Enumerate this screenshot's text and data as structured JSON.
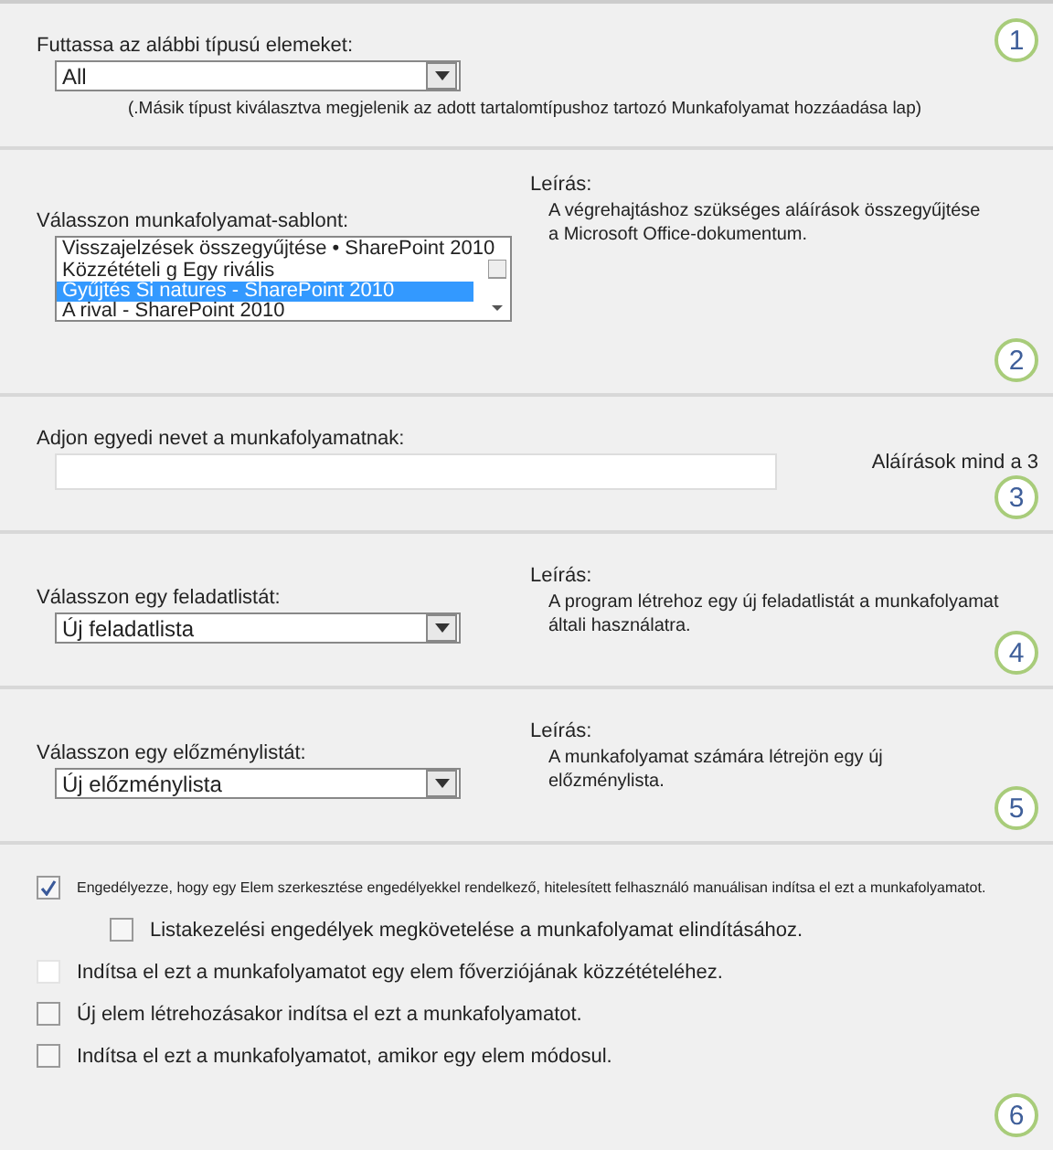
{
  "item_type": {
    "step": "1",
    "label": "Futtassa az alábbi típusú elemeket:",
    "dropdown": {
      "value": "All"
    },
    "note": "(.Másik típust kiválasztva megjelenik az adott tartalomtípushoz tartozó Munkafolyamat hozzáadása lap)"
  },
  "template": {
    "step": "2",
    "label": "Válasszon munkafolyamat-sablont:",
    "items": [
      {
        "text": "Visszajelzések összegyűjtése • SharePoint 2010",
        "selected": false
      },
      {
        "text": "Közzétételi g Egy rivális",
        "selected": false
      },
      {
        "text": "Gyűjtés Si natures - SharePoint 2010",
        "selected": true
      },
      {
        "text": "A rival - SharePoint 2010",
        "selected": false
      }
    ],
    "description_heading": "Leírás:",
    "description": [
      "A végrehajtáshoz szükséges aláírások összegyűjtése",
      "a Microsoft Office-dokumentum."
    ]
  },
  "name": {
    "step": "3",
    "label": "Adjon egyedi nevet a munkafolyamatnak:",
    "side_text": "Aláírások mind a 3"
  },
  "task_list": {
    "step": "4",
    "label": "Válasszon egy feladatlistát:",
    "dropdown": {
      "value": "Új feladatlista"
    },
    "description_heading": "Leírás:",
    "description": [
      "A program létrehoz egy új feladatlistát a munkafolyamat",
      "általi használatra."
    ]
  },
  "history_list": {
    "step": "5",
    "label": "Válasszon egy előzménylistát:",
    "dropdown": {
      "value": "Új előzménylista"
    },
    "description_heading": "Leírás:",
    "description": [
      "A munkafolyamat számára létrejön egy új",
      "előzménylista."
    ]
  },
  "start_options": {
    "step": "6",
    "options": [
      {
        "label": "Engedélyezze, hogy egy Elem szerkesztése engedélyekkel rendelkező, hitelesített felhasználó manuálisan indítsa el ezt a munkafolyamatot.",
        "checked": true,
        "disabled": false,
        "children": [
          {
            "label": "Listakezelési engedélyek megkövetelése a munkafolyamat elindításához.",
            "checked": false,
            "disabled": false
          }
        ]
      },
      {
        "label": "Indítsa el ezt a munkafolyamatot egy elem főverziójának közzétételéhez.",
        "checked": false,
        "disabled": true
      },
      {
        "label": "Új elem létrehozásakor indítsa el ezt a munkafolyamatot.",
        "checked": false,
        "disabled": false
      },
      {
        "label": "Indítsa el ezt a munkafolyamatot, amikor egy elem módosul.",
        "checked": false,
        "disabled": false
      }
    ]
  }
}
